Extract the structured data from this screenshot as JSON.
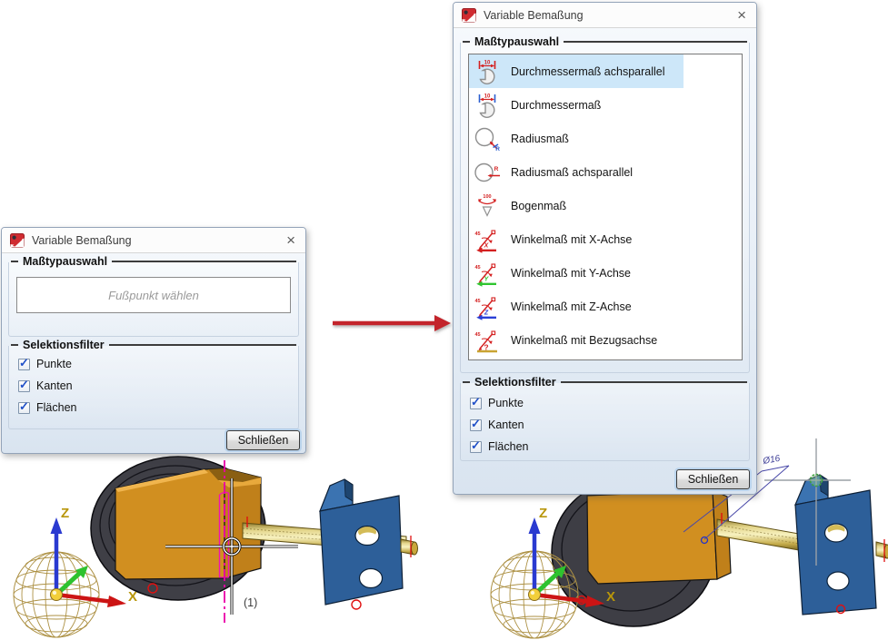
{
  "icon_glyphs": {
    "diameter_value": "10",
    "arc_value": "100",
    "angle_value": "45",
    "radius_letter": "R",
    "axis_x": "X",
    "axis_y": "Y",
    "axis_z": "Z",
    "ref_mark": "?",
    "check_glyph": "✓"
  },
  "colors": {
    "selection_blue": "#cde7f9",
    "dialog_border": "#93a3b8",
    "arrow_red": "#c3242b",
    "check_blue": "#2050c8"
  },
  "dialog_left": {
    "title": "Variable Bemaßung",
    "close_glyph": "×",
    "masstyp": {
      "label": "Maßtypauswahl",
      "placeholder": "Fußpunkt wählen"
    },
    "selektion": {
      "label": "Selektionsfilter",
      "checkboxes": [
        {
          "label": "Punkte",
          "checked": true
        },
        {
          "label": "Kanten",
          "checked": true
        },
        {
          "label": "Flächen",
          "checked": true
        }
      ]
    },
    "close_button": "Schließen"
  },
  "dialog_right": {
    "title": "Variable Bemaßung",
    "close_glyph": "×",
    "masstyp": {
      "label": "Maßtypauswahl",
      "items": [
        {
          "label": "Durchmessermaß achsparallel",
          "icon": "diameter-axisparallel-icon",
          "selected": true
        },
        {
          "label": "Durchmessermaß",
          "icon": "diameter-icon",
          "selected": false
        },
        {
          "label": "Radiusmaß",
          "icon": "radius-icon",
          "selected": false
        },
        {
          "label": "Radiusmaß achsparallel",
          "icon": "radius-axisparallel-icon",
          "selected": false
        },
        {
          "label": "Bogenmaß",
          "icon": "arc-icon",
          "selected": false
        },
        {
          "label": "Winkelmaß mit X-Achse",
          "icon": "angle-x-icon",
          "selected": false
        },
        {
          "label": "Winkelmaß mit Y-Achse",
          "icon": "angle-y-icon",
          "selected": false
        },
        {
          "label": "Winkelmaß mit Z-Achse",
          "icon": "angle-z-icon",
          "selected": false
        },
        {
          "label": "Winkelmaß mit Bezugsachse",
          "icon": "angle-ref-icon",
          "selected": false
        }
      ]
    },
    "selektion": {
      "label": "Selektionsfilter",
      "checkboxes": [
        {
          "label": "Punkte",
          "checked": true
        },
        {
          "label": "Kanten",
          "checked": true
        },
        {
          "label": "Flächen",
          "checked": true
        }
      ]
    },
    "close_button": "Schließen"
  },
  "scene_left": {
    "z_label": "Z",
    "x_label": "X",
    "annotation": "(1)"
  },
  "scene_right": {
    "z_label": "Z",
    "x_label": "X",
    "dimension_label": "Ø16"
  }
}
